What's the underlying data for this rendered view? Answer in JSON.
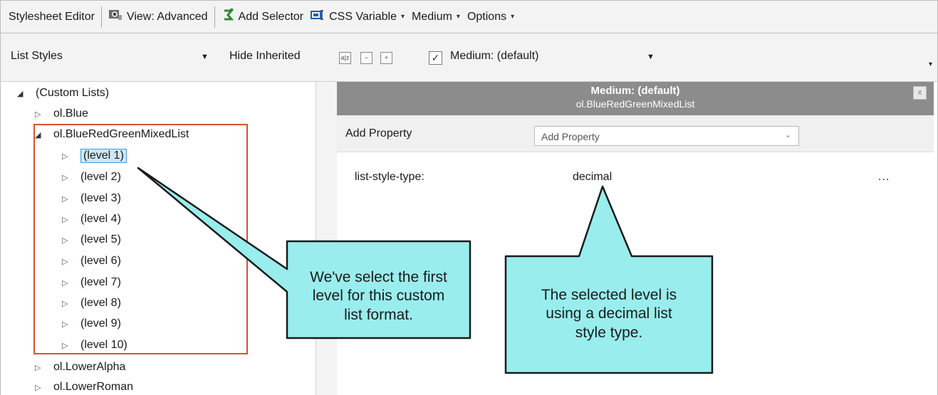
{
  "toolbar": {
    "stylesheet_editor": "Stylesheet Editor",
    "view": "View: Advanced",
    "add_selector": "Add Selector",
    "css_variable": "CSS Variable",
    "medium": "Medium",
    "options": "Options"
  },
  "filterbar": {
    "list_styles": "List Styles",
    "hide_inherited": "Hide Inherited",
    "medium_select": "Medium: (default)"
  },
  "tree": {
    "root": "(Custom Lists)",
    "items": [
      "ol.Blue",
      "ol.BlueRedGreenMixedList",
      "ol.LowerAlpha",
      "ol.LowerRoman"
    ],
    "levels": [
      "(level 1)",
      "(level 2)",
      "(level 3)",
      "(level 4)",
      "(level 5)",
      "(level 6)",
      "(level 7)",
      "(level 8)",
      "(level 9)",
      "(level 10)"
    ]
  },
  "panel": {
    "title": "Medium: (default)",
    "subtitle": "ol.BlueRedGreenMixedList",
    "close": "x",
    "add_property_label": "Add Property",
    "add_property_placeholder": "Add Property",
    "property_name": "list-style-type:",
    "property_value": "decimal",
    "more": "..."
  },
  "callouts": {
    "left": [
      "We've select the first",
      "level for this custom",
      "list format."
    ],
    "right": [
      "The selected level is",
      "using a decimal list",
      "style type."
    ]
  },
  "colors": {
    "callout_fill": "#99eded",
    "highlight_box": "#d9532b",
    "selection": "#cde7f9"
  }
}
